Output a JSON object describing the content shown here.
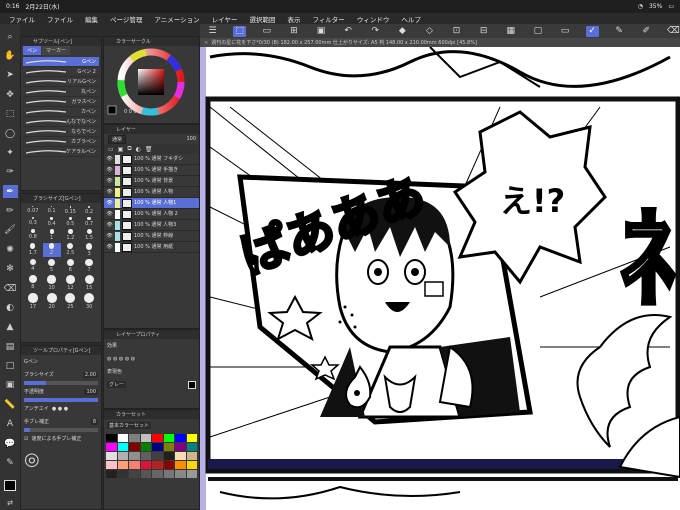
{
  "status": {
    "time": "0:16",
    "date": "2月22日(水)",
    "battery": "35%"
  },
  "menu": [
    "ファイル",
    "ファイル",
    "編集",
    "ページ管理",
    "アニメーション",
    "レイヤー",
    "選択範囲",
    "表示",
    "フィルター",
    "ウィンドウ",
    "ヘルプ"
  ],
  "tab": {
    "title": "週刊の星に花を下さ*0/30 (B) 182.00 x 257.00mm 仕上がりサイズ: A5 判 148.00 x 210.00mm 600dpi [45.8%]",
    "close": "×"
  },
  "panels": {
    "subtool_title": "サブツール[ペン]",
    "subtool_tabs": [
      "ペン",
      "マーカー"
    ],
    "brushes": [
      "Gペン",
      "Gペン 2",
      "リアルGペン",
      "丸ペン",
      "ガラスペン",
      "カペン",
      "んなでなペン",
      "ならでペン",
      "カブラペン",
      "ケアラルペン"
    ],
    "brushsize_title": "ブラシサイズ[Gペン]",
    "sizes": [
      "0.07",
      "0.1",
      "0.15",
      "0.2",
      "0.3",
      "0.4",
      "0.5",
      "0.7",
      "0.8",
      "1",
      "1.2",
      "1.5",
      "1.7",
      "2",
      "2.5",
      "3",
      "4",
      "5",
      "6",
      "7",
      "8",
      "10",
      "12",
      "15",
      "17",
      "20",
      "25",
      "30"
    ],
    "toolprop_title": "ツールプロパティ[Gペン]",
    "toolprop_brush": "Gペン",
    "brush_size_label": "ブラシサイズ",
    "brush_size_value": "2.00",
    "opacity_label": "不透明度",
    "opacity_value": "100",
    "antialias_label": "アンチエイ",
    "stabilize_label": "手ブレ補正",
    "stabilize_value": "8",
    "speed_label": "速度による手ブレ補正",
    "colorcircle_title": "カラーサークル",
    "color_values": "0  0  0",
    "layer_title": "レイヤー",
    "blend_mode": "通常",
    "layer_opacity": "100",
    "layers": [
      {
        "name": "100 %  通常\nフキダシ",
        "color": "#e0e0e0"
      },
      {
        "name": "100 %  通常\n手描き",
        "color": "#d9b3d9"
      },
      {
        "name": "100 %  通常\n背景",
        "color": "#c8e6a0"
      },
      {
        "name": "100 %  通常\n人物",
        "color": "#f0f08a"
      },
      {
        "name": "100 %  通常\n人物1",
        "color": "#f0f08a"
      },
      {
        "name": "100 %  通常\n人物 2",
        "color": "#ffffff"
      },
      {
        "name": "100 %  通常\n人物3",
        "color": "#a6e0e6"
      },
      {
        "name": "100 %  通常\n枠線",
        "color": "#a6e0e6"
      },
      {
        "name": "100 %  通常\n用紙",
        "color": "#ffffff"
      }
    ],
    "layerprop_title": "レイヤープロパティ",
    "effect_label": "効果",
    "expression_label": "表現色",
    "expression_value": "グレー",
    "colorset_title": "カラーセット",
    "colorset_name": "基本カラーセット"
  },
  "swatches": [
    "#000000",
    "#ffffff",
    "#7f7f7f",
    "#c0c0c0",
    "#ff0000",
    "#00ff00",
    "#0000ff",
    "#ffff00",
    "#ff00ff",
    "#00ffff",
    "#800000",
    "#008000",
    "#000080",
    "#808000",
    "#800080",
    "#008080",
    "#e0e0e0",
    "#b0b0b0",
    "#909090",
    "#606060",
    "#404040",
    "#202020",
    "#f5deb3",
    "#d2b48c",
    "#ffc0cb",
    "#ffa07a",
    "#fa8072",
    "#dc143c",
    "#b22222",
    "#8b0000",
    "#ff8c00",
    "#ffd700",
    "#222222",
    "#333333",
    "#444444",
    "#555555",
    "#666666",
    "#777777",
    "#888888",
    "#999999"
  ],
  "canvas": {
    "sfx_text": "ぱあああ",
    "bubble_text": "え!?",
    "side_sfx": "ﾈ"
  }
}
